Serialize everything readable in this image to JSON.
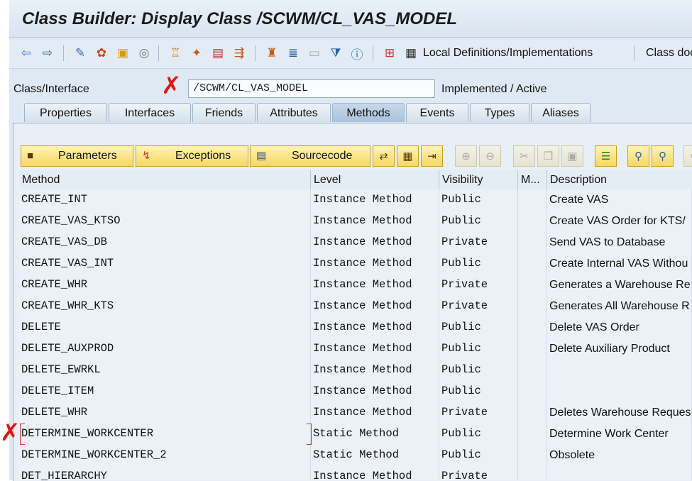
{
  "title": "Class Builder: Display Class /SCWM/CL_VAS_MODEL",
  "toolbar": {
    "local_defs_label": "Local Definitions/Implementations",
    "class_doc_label": "Class doc",
    "icons": [
      "back-arrow-icon",
      "forward-arrow-icon",
      "other-object-icon",
      "activate-icon",
      "display-change-icon",
      "where-used-icon",
      "hierarchy-icon",
      "wand-icon",
      "dictionary-icon",
      "navigate-icon",
      "object-list-icon",
      "enhance-icon",
      "box-icon",
      "filter-icon",
      "info-icon",
      "local-types-icon",
      "local-defs-icon"
    ]
  },
  "header": {
    "class_label": "Class/Interface",
    "class_value": "/SCWM/CL_VAS_MODEL",
    "status": "Implemented / Active"
  },
  "tabs": [
    "Properties",
    "Interfaces",
    "Friends",
    "Attributes",
    "Methods",
    "Events",
    "Types",
    "Aliases"
  ],
  "active_tab": "Methods",
  "actions": {
    "parameters": "Parameters",
    "exceptions": "Exceptions",
    "sourcecode": "Sourcecode"
  },
  "grid": {
    "columns": [
      "Method",
      "Level",
      "Visibility",
      "M...",
      "Description"
    ],
    "rows": [
      {
        "method": "CREATE_INT",
        "level": "Instance Method",
        "visibility": "Public",
        "m": "",
        "description": "Create VAS"
      },
      {
        "method": "CREATE_VAS_KTSO",
        "level": "Instance Method",
        "visibility": "Public",
        "m": "",
        "description": "Create VAS Order for KTS/"
      },
      {
        "method": "CREATE_VAS_DB",
        "level": "Instance Method",
        "visibility": "Private",
        "m": "",
        "description": "Send VAS to Database"
      },
      {
        "method": "CREATE_VAS_INT",
        "level": "Instance Method",
        "visibility": "Public",
        "m": "",
        "description": "Create Internal VAS Withou"
      },
      {
        "method": "CREATE_WHR",
        "level": "Instance Method",
        "visibility": "Private",
        "m": "",
        "description": "Generates a Warehouse Re"
      },
      {
        "method": "CREATE_WHR_KTS",
        "level": "Instance Method",
        "visibility": "Private",
        "m": "",
        "description": "Generates All Warehouse R"
      },
      {
        "method": "DELETE",
        "level": "Instance Method",
        "visibility": "Public",
        "m": "",
        "description": "Delete VAS Order"
      },
      {
        "method": "DELETE_AUXPROD",
        "level": "Instance Method",
        "visibility": "Public",
        "m": "",
        "description": "Delete Auxiliary Product"
      },
      {
        "method": "DELETE_EWRKL",
        "level": "Instance Method",
        "visibility": "Public",
        "m": "",
        "description": ""
      },
      {
        "method": "DELETE_ITEM",
        "level": "Instance Method",
        "visibility": "Public",
        "m": "",
        "description": ""
      },
      {
        "method": "DELETE_WHR",
        "level": "Instance Method",
        "visibility": "Private",
        "m": "",
        "description": "Deletes Warehouse Reques"
      },
      {
        "method": "DETERMINE_WORKCENTER",
        "level": "Static Method",
        "visibility": "Public",
        "m": "",
        "description": "Determine Work Center"
      },
      {
        "method": "DETERMINE_WORKCENTER_2",
        "level": "Static Method",
        "visibility": "Public",
        "m": "",
        "description": "Obsolete"
      },
      {
        "method": "DET_HIERARCHY",
        "level": "Instance Method",
        "visibility": "Private",
        "m": "",
        "description": ""
      }
    ]
  },
  "annotations": {
    "marker_symbol": "✗",
    "color": "#e01616"
  }
}
